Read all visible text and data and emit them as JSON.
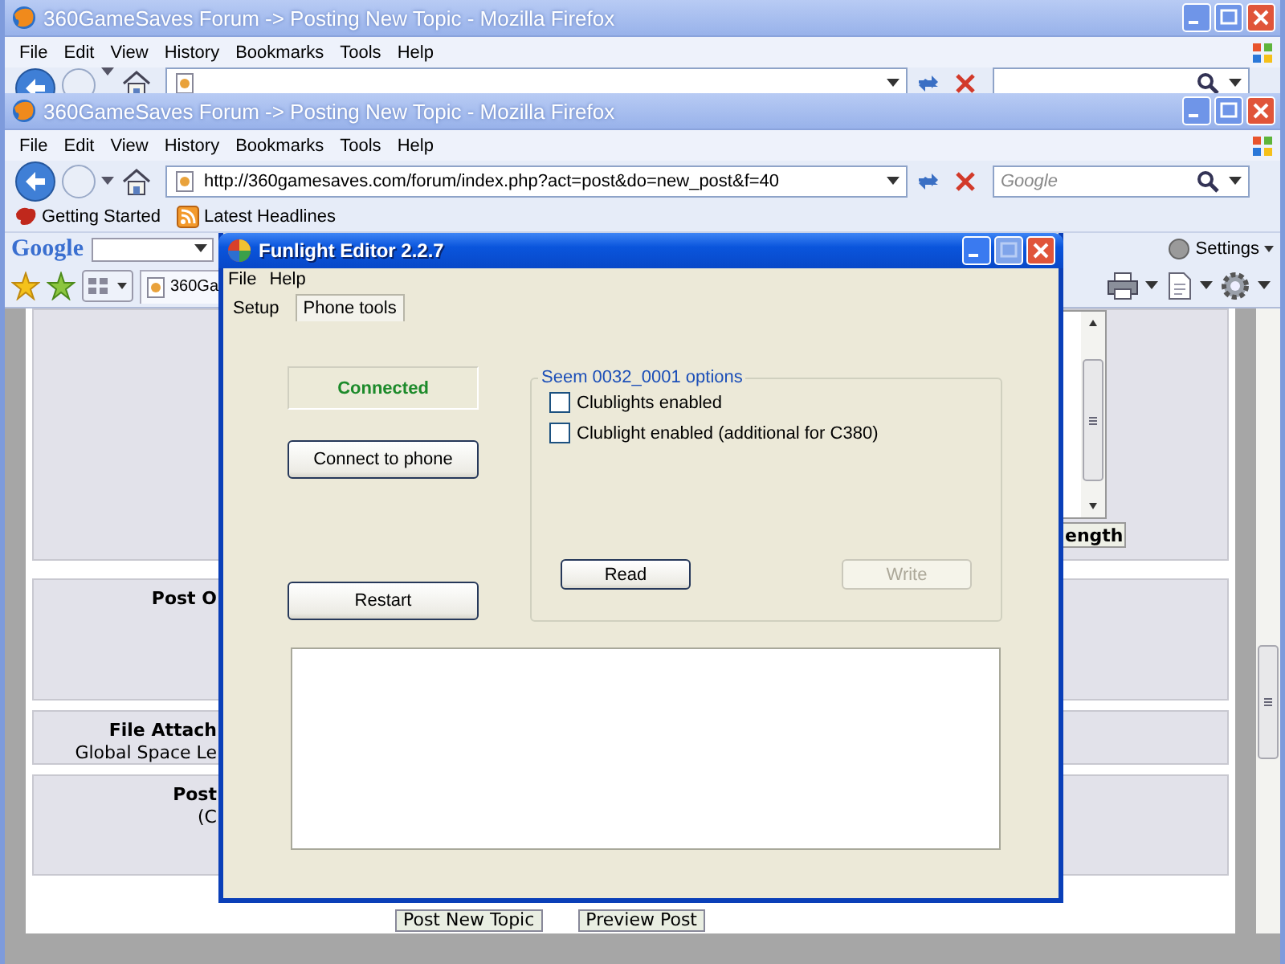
{
  "background_window": {
    "title": "360GameSaves Forum -> Posting New Topic - Mozilla Firefox",
    "menu": [
      "File",
      "Edit",
      "View",
      "History",
      "Bookmarks",
      "Tools",
      "Help"
    ]
  },
  "browser": {
    "title": "360GameSaves Forum -> Posting New Topic - Mozilla Firefox",
    "menu": [
      "File",
      "Edit",
      "View",
      "History",
      "Bookmarks",
      "Tools",
      "Help"
    ],
    "address": "http://360gamesaves.com/forum/index.php?act=post&do=new_post&f=40",
    "search_placeholder": "Google",
    "bookmarks": [
      {
        "label": "Getting Started",
        "kind": "bookmark"
      },
      {
        "label": "Latest Headlines",
        "kind": "feed"
      }
    ],
    "google_toolbar": {
      "logo": "Google",
      "settings": "Settings"
    },
    "tabs": [
      {
        "label": "360Ga",
        "selected": true
      }
    ],
    "page": {
      "side_button": "ength",
      "fields": [
        {
          "label": "Post O"
        },
        {
          "label": "File Attach",
          "note": "Global Space Le"
        },
        {
          "label": "Post",
          "note": "(C"
        }
      ],
      "buttons": [
        "Post New Topic",
        "Preview Post"
      ]
    }
  },
  "dialog": {
    "title": "Funlight Editor 2.2.7",
    "menu": [
      "File",
      "Help"
    ],
    "tabs": [
      {
        "label": "Setup",
        "selected": false
      },
      {
        "label": "Phone tools",
        "selected": true
      }
    ],
    "status": {
      "text": "Connected",
      "connected": true
    },
    "connect_button": {
      "label": "Connect to phone",
      "disabled": false
    },
    "restart_button": {
      "label": "Restart",
      "disabled": false
    },
    "options": {
      "legend": "Seem 0032_0001 options",
      "checkboxes": [
        {
          "label": "Clublights enabled",
          "checked": false
        },
        {
          "label": "Clublight enabled (additional for C380)",
          "checked": false
        }
      ],
      "buttons": [
        {
          "label": "Read",
          "disabled": false
        },
        {
          "label": "Write",
          "disabled": true
        }
      ]
    }
  }
}
